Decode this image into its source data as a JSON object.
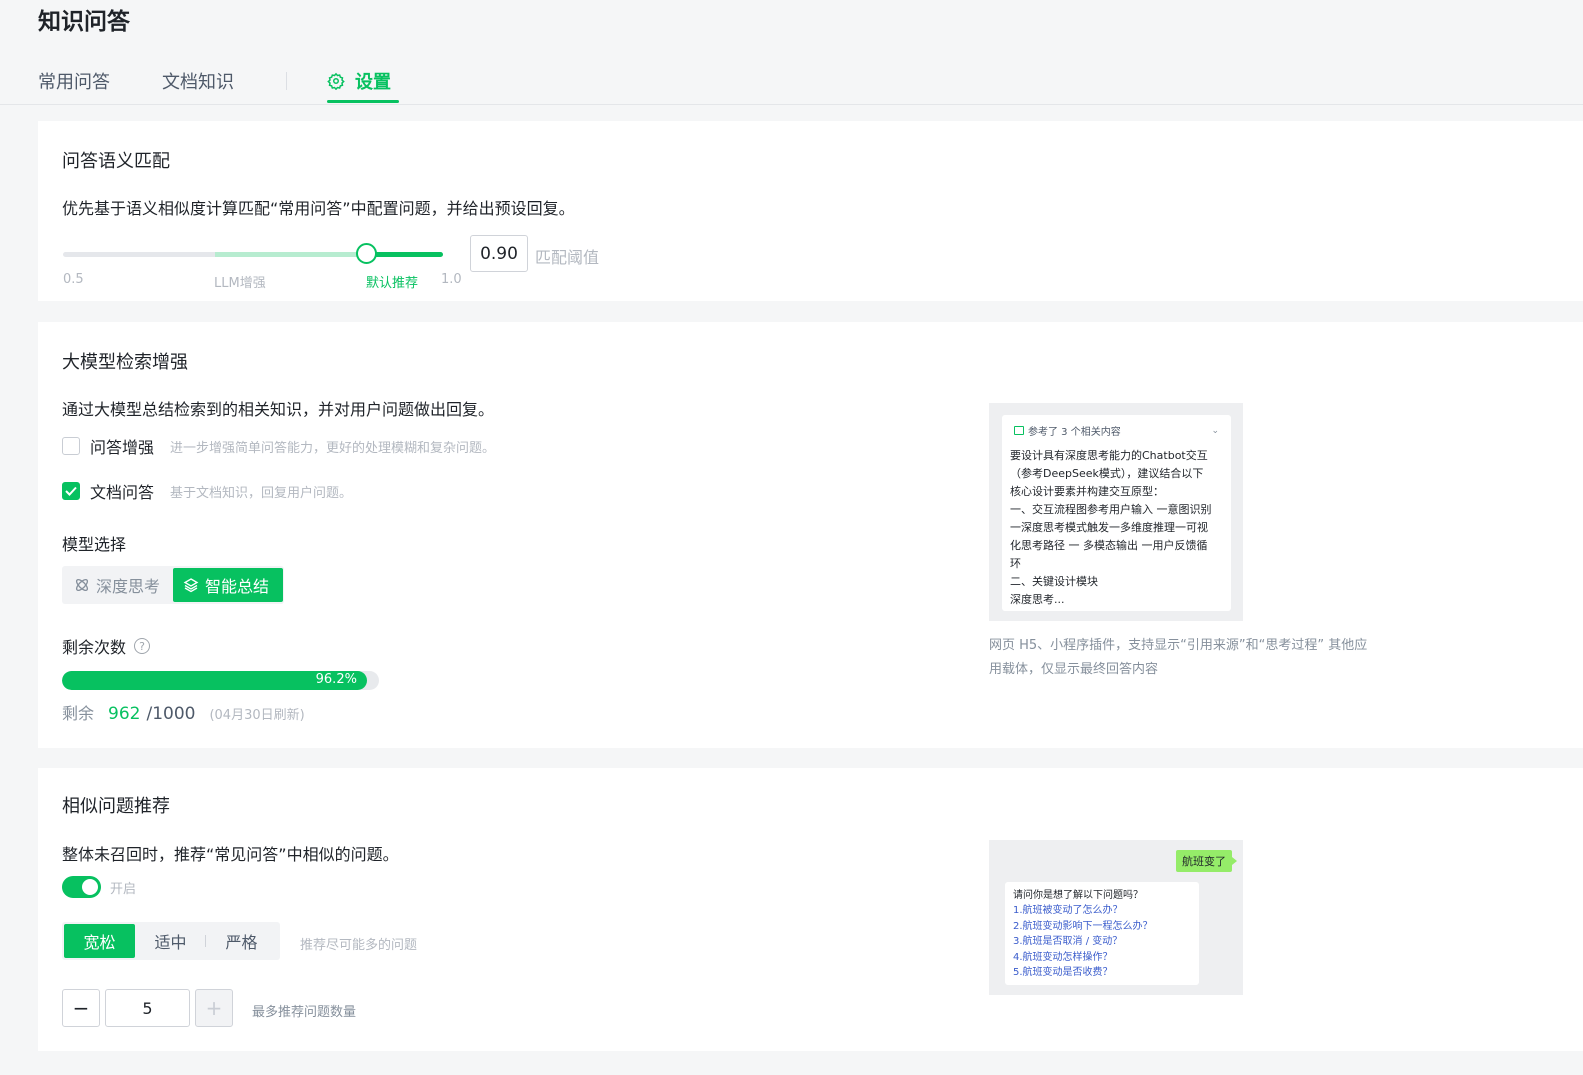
{
  "page": {
    "title": "知识问答"
  },
  "tabs": [
    {
      "label": "常用问答"
    },
    {
      "label": "文档知识"
    },
    {
      "label": "设置",
      "active": true,
      "icon": "gear-icon"
    }
  ],
  "colors": {
    "accent": "#07c160",
    "user_bubble": "#95ec69",
    "link": "#3a5ccc"
  },
  "semantic_match": {
    "title": "问答语义匹配",
    "desc": "优先基于语义相似度计算匹配“常用问答”中配置问题，并给出预设回复。",
    "slider": {
      "min_label": "0.5",
      "llm_label": "LLM增强",
      "default_label": "默认推荐",
      "max_label": "1.0",
      "value": 0.9
    },
    "threshold_value": "0.90",
    "threshold_label": "匹配阈值"
  },
  "llm_enhance": {
    "title": "大模型检索增强",
    "desc": "通过大模型总结检索到的相关知识，并对用户问题做出回复。",
    "qa_enhance": {
      "label": "问答增强",
      "hint": "进一步增强简单问答能力，更好的处理模糊和复杂问题。",
      "checked": false
    },
    "doc_qa": {
      "label": "文档问答",
      "hint": "基于文档知识，回复用户问题。",
      "checked": true
    },
    "model_title": "模型选择",
    "models": [
      {
        "label": "深度思考",
        "icon": "brain-icon",
        "selected": false
      },
      {
        "label": "智能总结",
        "icon": "layers-icon",
        "selected": true
      }
    ],
    "quota": {
      "title": "剩余次数",
      "help_icon": "help-circle-icon",
      "help_glyph": "?",
      "percent_text": "96.2%",
      "percent": 96.2,
      "remain_prefix": "剩余",
      "remain": "962",
      "total": "/1000",
      "refresh": "(04月30日刷新)"
    },
    "preview": {
      "ref_text": "参考了 3 个相关内容",
      "chevron_glyph": "⌄",
      "lines": [
        "要设计具有深度思考能力的Chatbot交互",
        "（参考DeepSeek模式），建议结合以下",
        "核心设计要素并构建交互原型：",
        "一、交互流程图参考用户输入 一意图识别",
        "一深度思考模式触发一多维度推理一可视",
        "化思考路径 一 多模态输出 一用户反馈循",
        "环",
        "二、关键设计模块",
        "深度思考..."
      ],
      "caption": "网页 H5、小程序插件，支持显示“引用来源”和“思考过程” 其他应用载体，仅显示最终回答内容"
    }
  },
  "similar": {
    "title": "相似问题推荐",
    "desc": "整体未召回时，推荐“常见问答”中相似的问题。",
    "toggle_label": "开启",
    "toggle_on": true,
    "strictness": [
      {
        "label": "宽松",
        "selected": true
      },
      {
        "label": "适中",
        "selected": false
      },
      {
        "label": "严格",
        "selected": false
      }
    ],
    "strictness_hint": "推荐尽可能多的问题",
    "minus_glyph": "−",
    "plus_glyph": "+",
    "max_count": "5",
    "max_hint": "最多推荐问题数量",
    "preview": {
      "user_msg": "航班变了",
      "bot_title": "请问你是想了解以下问题吗？",
      "questions": [
        "1.航班被变动了怎么办？",
        "2.航班变动影响下一程怎么办？",
        "3.航班是否取消 / 变动？",
        "4.航班变动怎样操作？",
        "5.航班变动是否收费？"
      ]
    }
  }
}
